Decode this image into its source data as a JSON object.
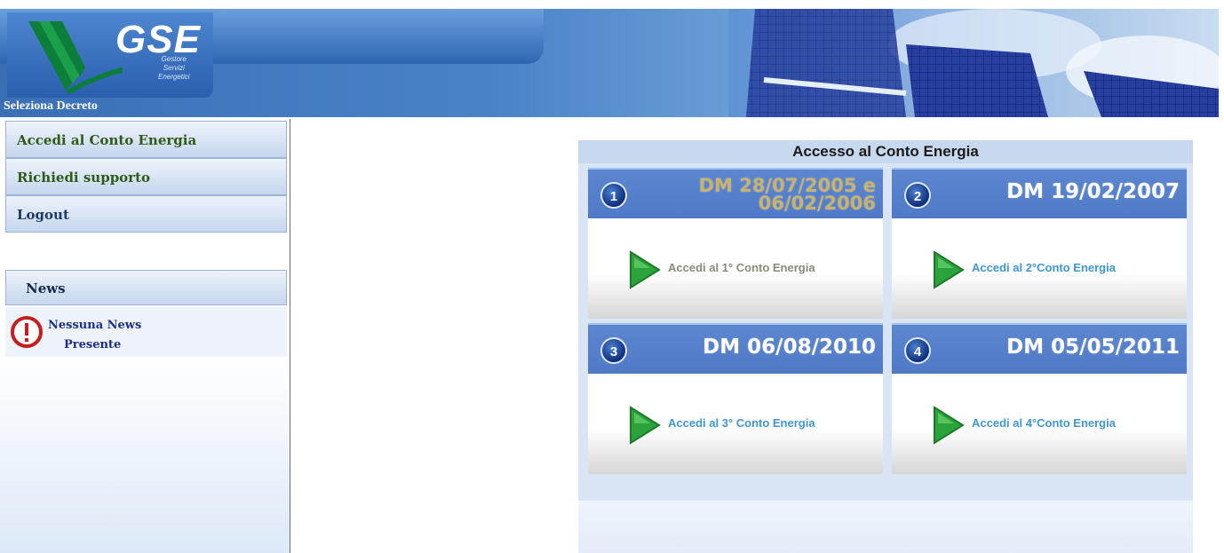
{
  "header": {
    "logo_text": "GSE",
    "logo_subtitle_1": "Gestore",
    "logo_subtitle_2": "Servizi",
    "logo_subtitle_3": "Energetici",
    "section_label": "Seleziona Decreto"
  },
  "sidebar": {
    "items": [
      {
        "label": "Accedi al Conto Energia"
      },
      {
        "label": "Richiedi supporto"
      },
      {
        "label": "Logout"
      }
    ],
    "news_title": "News",
    "news_line1": "Nessuna News",
    "news_line2": "Presente"
  },
  "main": {
    "title": "Accesso al Conto Energia",
    "cards": [
      {
        "number": "1",
        "dm": "DM 28/07/2005 e 06/02/2006",
        "link": "Accedi al 1° Conto Energia"
      },
      {
        "number": "2",
        "dm": "DM 19/02/2007",
        "link": "Accedi al 2°Conto Energia"
      },
      {
        "number": "3",
        "dm": "DM 06/08/2010",
        "link": "Accedi al 3° Conto Energia"
      },
      {
        "number": "4",
        "dm": "DM 05/05/2011",
        "link": "Accedi al 4°Conto Energia"
      }
    ]
  },
  "colors": {
    "header_blue": "#3a6fb6",
    "card_head": "#5c86cf",
    "link_blue": "#3d97d4",
    "menu_green": "#2e5b16"
  }
}
